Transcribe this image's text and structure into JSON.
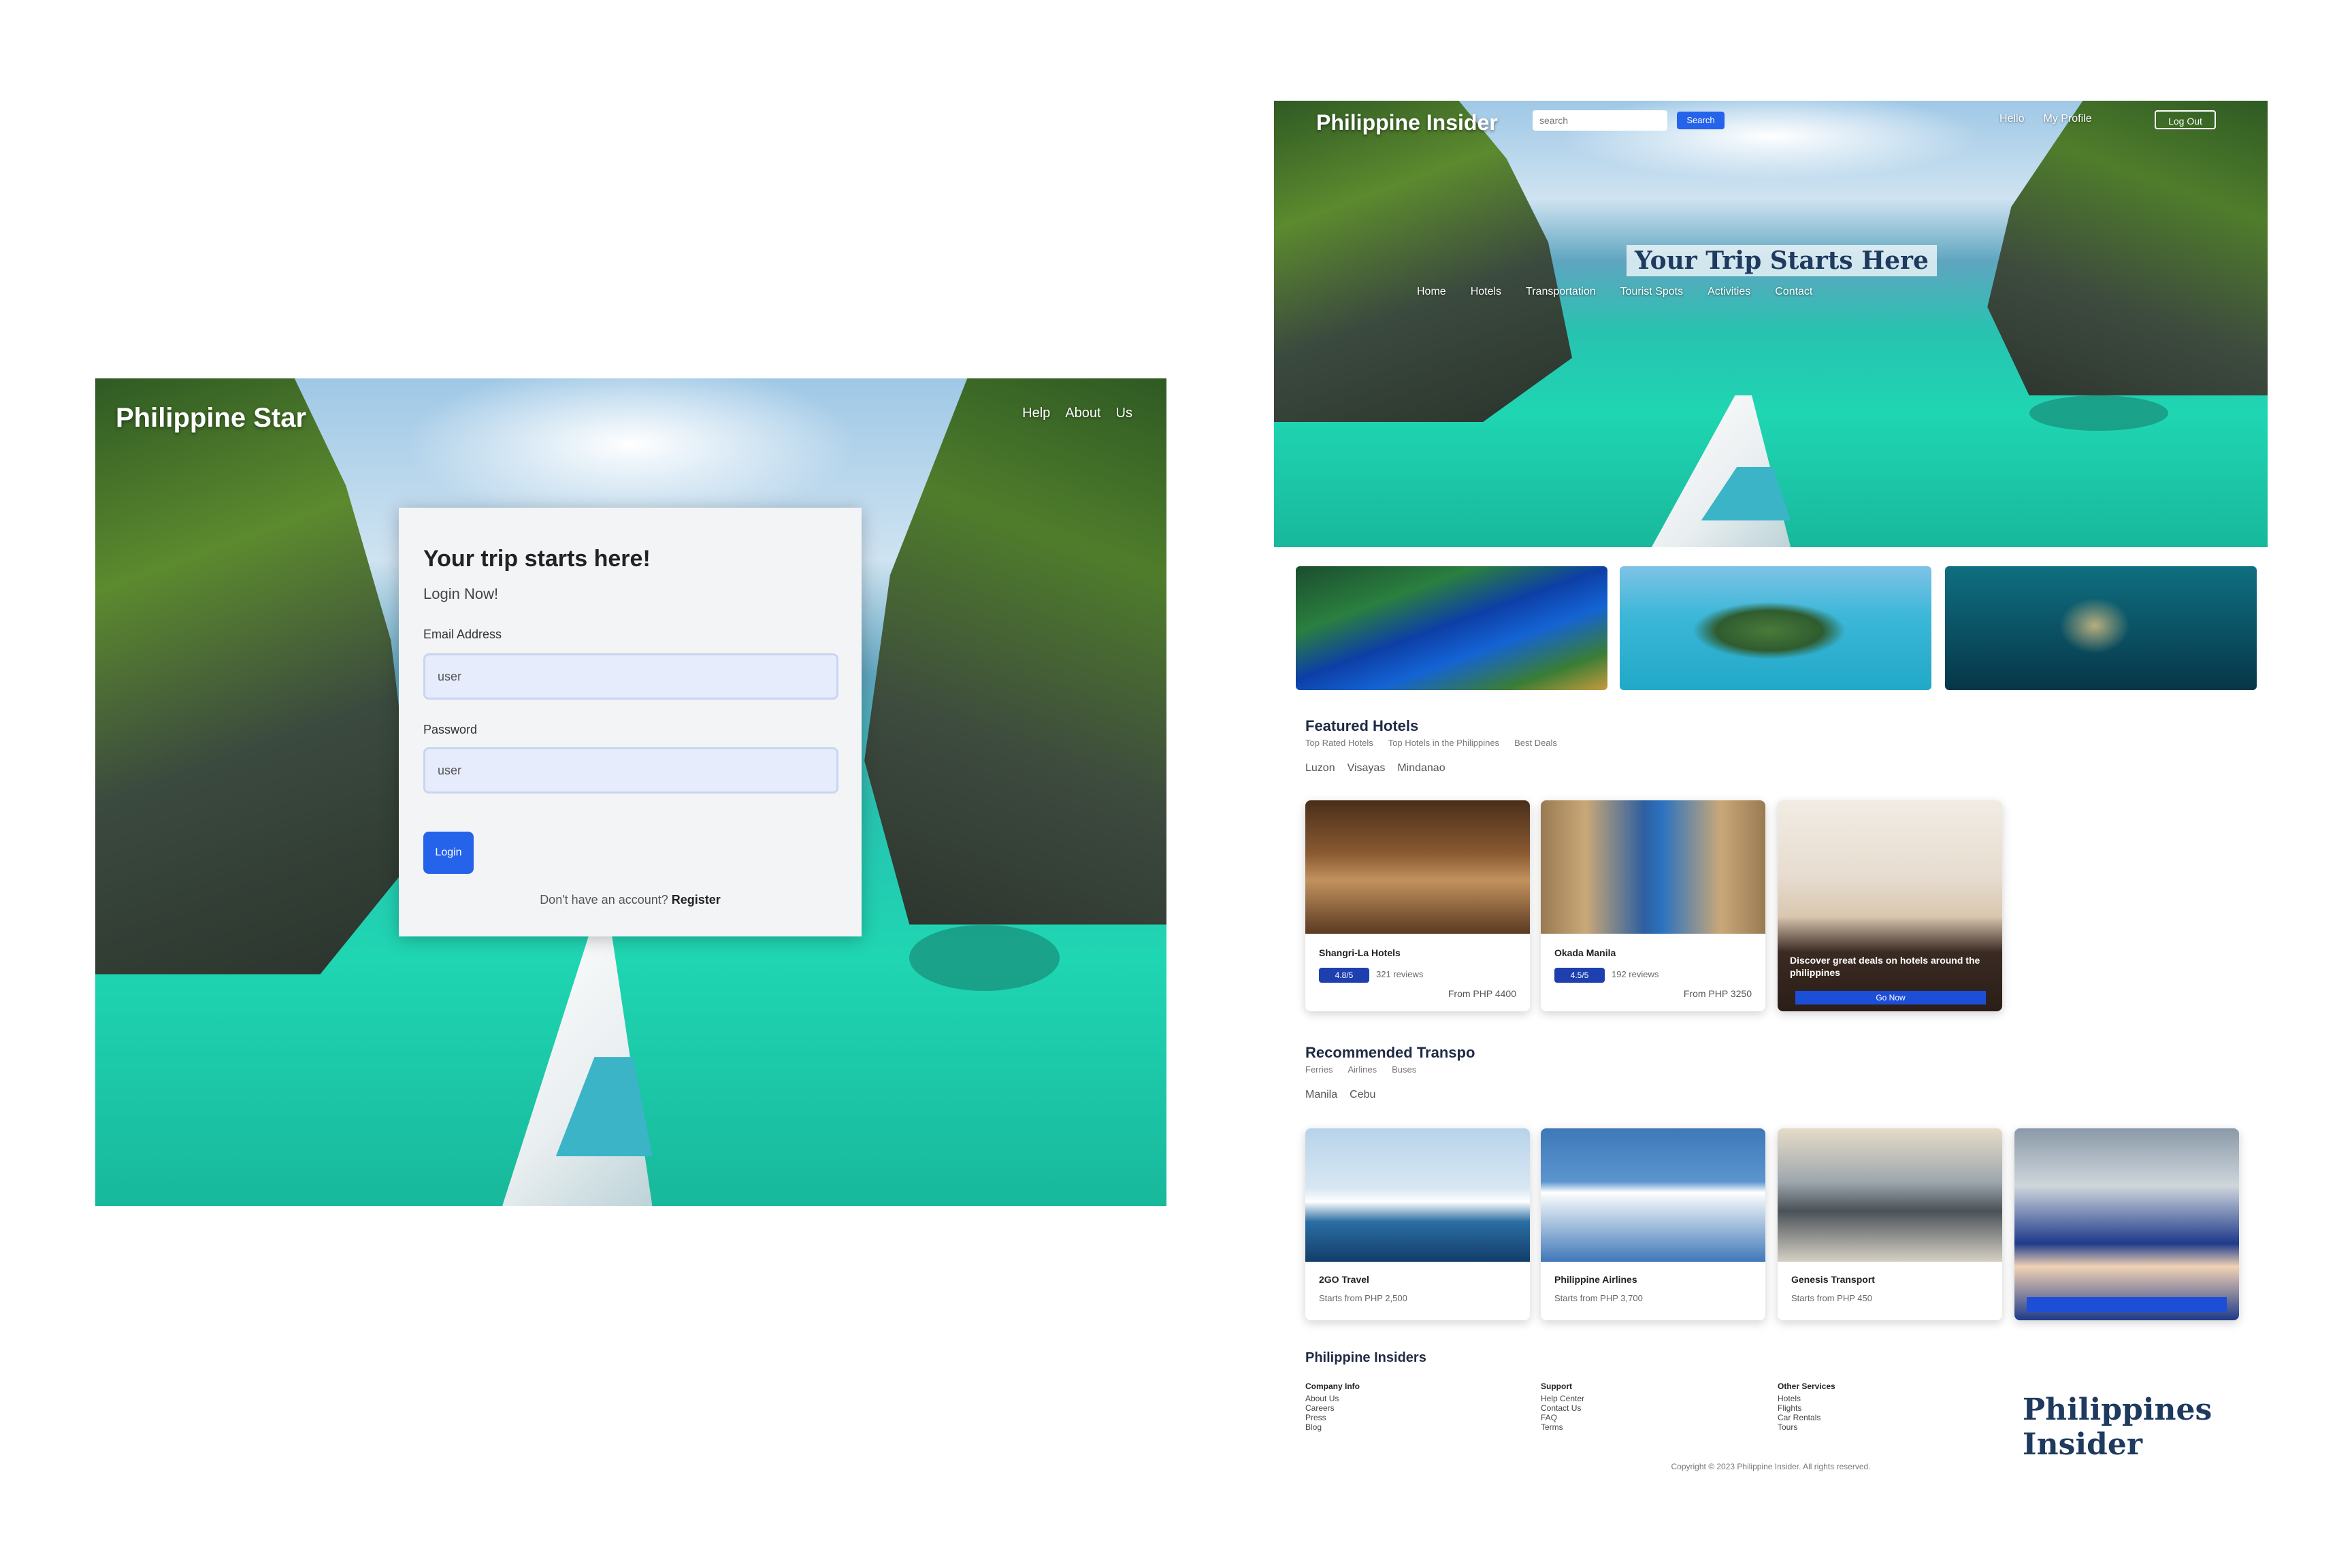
{
  "login": {
    "brand": "Philippine Star",
    "nav": [
      "Help",
      "About",
      "Us"
    ],
    "card_title": "Your trip starts here!",
    "card_sub": "Login Now!",
    "email_label": "Email Address",
    "email_value": "user",
    "password_label": "Password",
    "password_value": "user",
    "login_button": "Login",
    "register_text": "Don't have an account?",
    "register_link": "Register"
  },
  "home": {
    "brand": "Philippine Insider",
    "search_placeholder": "search",
    "search_button": "Search",
    "user_links": [
      "Hello",
      "My Profile"
    ],
    "logout": "Log Out",
    "hero_title": "Your Trip Starts Here",
    "hero_nav": [
      "Home",
      "Hotels",
      "Transportation",
      "Tourist Spots",
      "Activities",
      "Contact"
    ],
    "hotels": {
      "title": "Featured Hotels",
      "subtitle": [
        "Top Rated Hotels",
        "Top Hotels in the Philippines",
        "Best Deals"
      ],
      "tabs": [
        "Luzon",
        "Visayas",
        "Mindanao"
      ],
      "cards": [
        {
          "name": "Shangri-La Hotels",
          "rating": "4.8/5",
          "reviews": "321 reviews",
          "price": "From PHP 4400"
        },
        {
          "name": "Okada Manila",
          "rating": "4.5/5",
          "reviews": "192 reviews",
          "price": "From PHP 3250"
        }
      ],
      "promo_text": "Discover great deals on hotels around the philippines",
      "promo_button": "Go Now"
    },
    "transpo": {
      "title": "Recommended Transpo",
      "subtitle": [
        "Ferries",
        "Airlines",
        "Buses"
      ],
      "tabs": [
        "Manila",
        "Cebu"
      ],
      "cards": [
        {
          "name": "2GO Travel",
          "price": "Starts from PHP 2,500"
        },
        {
          "name": "Philippine Airlines",
          "price": "Starts from PHP 3,700"
        },
        {
          "name": "Genesis Transport",
          "price": "Starts from PHP 450"
        }
      ]
    },
    "footer": {
      "title": "Philippine Insiders",
      "cols": [
        {
          "head": "Company Info",
          "items": [
            "About Us",
            "Careers",
            "Press",
            "Blog"
          ]
        },
        {
          "head": "Support",
          "items": [
            "Help Center",
            "Contact Us",
            "FAQ",
            "Terms"
          ]
        },
        {
          "head": "Other Services",
          "items": [
            "Hotels",
            "Flights",
            "Car Rentals",
            "Tours"
          ]
        }
      ],
      "logo_text": "Philippines Insider",
      "copyright": "Copyright © 2023 Philippine Insider. All rights reserved."
    }
  }
}
